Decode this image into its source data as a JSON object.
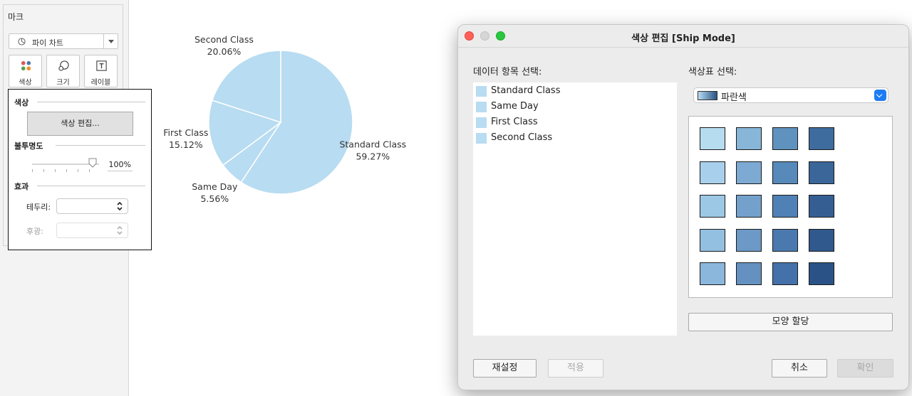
{
  "marks": {
    "title": "마크",
    "mark_type": "파이 차트",
    "buttons": [
      {
        "label": "색상",
        "icon": "color-dots-icon"
      },
      {
        "label": "크기",
        "icon": "size-icon"
      },
      {
        "label": "레이블",
        "icon": "label-icon"
      }
    ]
  },
  "color_popup": {
    "color_section": "색상",
    "edit_button": "색상 편집...",
    "opacity_section": "불투명도",
    "opacity_value": "100%",
    "opacity": 1.0,
    "effects_section": "효과",
    "border_label": "테두리:",
    "halo_label": "후광:"
  },
  "chart_data": {
    "type": "pie",
    "title": "",
    "color": "#b8dcf1",
    "edge_color": "#ffffff",
    "slices": [
      {
        "name": "Standard Class",
        "percent_label": "59.27%",
        "value": 59.27
      },
      {
        "name": "Same Day",
        "percent_label": "5.56%",
        "value": 5.56
      },
      {
        "name": "First Class",
        "percent_label": "15.12%",
        "value": 15.12
      },
      {
        "name": "Second Class",
        "percent_label": "20.06%",
        "value": 20.06
      }
    ]
  },
  "dialog": {
    "title": "색상 편집 [Ship Mode]",
    "data_items_label": "데이터 항목 선택:",
    "palette_label": "색상표 선택:",
    "palette_name": "파란색",
    "items": [
      {
        "name": "Standard Class",
        "color": "#b8dcf1"
      },
      {
        "name": "Same Day",
        "color": "#b8dcf1"
      },
      {
        "name": "First Class",
        "color": "#b8dcf1"
      },
      {
        "name": "Second Class",
        "color": "#b8dcf1"
      }
    ],
    "palette_colors": [
      [
        "#b6dcf0",
        "#87b6d9",
        "#6092bf",
        "#3f6c9e"
      ],
      [
        "#a8d0ec",
        "#7daad3",
        "#5789bb",
        "#3a6699"
      ],
      [
        "#9cc8e6",
        "#74a1cc",
        "#5081b6",
        "#355f93"
      ],
      [
        "#93bfe0",
        "#6c99c6",
        "#4a79b0",
        "#30598d"
      ],
      [
        "#8bb7dc",
        "#6591c1",
        "#4571aa",
        "#2b5286"
      ]
    ],
    "assign_button": "모양 할당",
    "reset_button": "재설정",
    "apply_button": "적용",
    "cancel_button": "취소",
    "ok_button": "확인"
  }
}
